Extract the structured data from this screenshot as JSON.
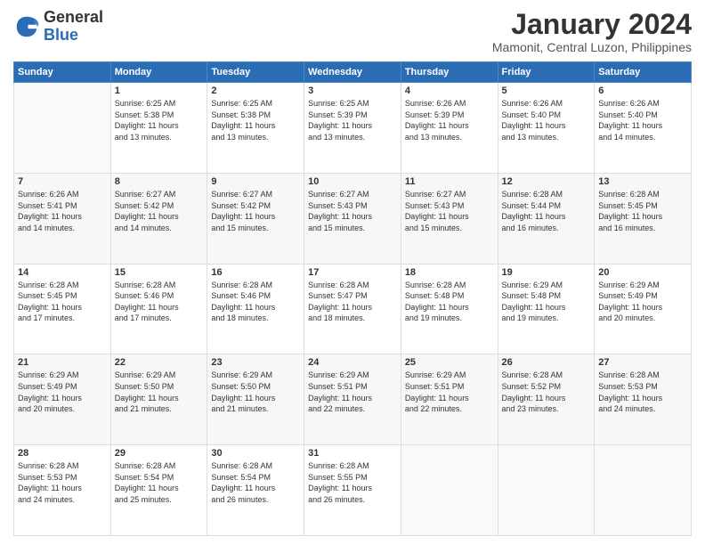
{
  "logo": {
    "general": "General",
    "blue": "Blue"
  },
  "header": {
    "month": "January 2024",
    "location": "Mamonit, Central Luzon, Philippines"
  },
  "weekdays": [
    "Sunday",
    "Monday",
    "Tuesday",
    "Wednesday",
    "Thursday",
    "Friday",
    "Saturday"
  ],
  "weeks": [
    [
      {
        "day": "",
        "sunrise": "",
        "sunset": "",
        "daylight": ""
      },
      {
        "day": "1",
        "sunrise": "Sunrise: 6:25 AM",
        "sunset": "Sunset: 5:38 PM",
        "daylight": "Daylight: 11 hours and 13 minutes."
      },
      {
        "day": "2",
        "sunrise": "Sunrise: 6:25 AM",
        "sunset": "Sunset: 5:38 PM",
        "daylight": "Daylight: 11 hours and 13 minutes."
      },
      {
        "day": "3",
        "sunrise": "Sunrise: 6:25 AM",
        "sunset": "Sunset: 5:39 PM",
        "daylight": "Daylight: 11 hours and 13 minutes."
      },
      {
        "day": "4",
        "sunrise": "Sunrise: 6:26 AM",
        "sunset": "Sunset: 5:39 PM",
        "daylight": "Daylight: 11 hours and 13 minutes."
      },
      {
        "day": "5",
        "sunrise": "Sunrise: 6:26 AM",
        "sunset": "Sunset: 5:40 PM",
        "daylight": "Daylight: 11 hours and 13 minutes."
      },
      {
        "day": "6",
        "sunrise": "Sunrise: 6:26 AM",
        "sunset": "Sunset: 5:40 PM",
        "daylight": "Daylight: 11 hours and 14 minutes."
      }
    ],
    [
      {
        "day": "7",
        "sunrise": "Sunrise: 6:26 AM",
        "sunset": "Sunset: 5:41 PM",
        "daylight": "Daylight: 11 hours and 14 minutes."
      },
      {
        "day": "8",
        "sunrise": "Sunrise: 6:27 AM",
        "sunset": "Sunset: 5:42 PM",
        "daylight": "Daylight: 11 hours and 14 minutes."
      },
      {
        "day": "9",
        "sunrise": "Sunrise: 6:27 AM",
        "sunset": "Sunset: 5:42 PM",
        "daylight": "Daylight: 11 hours and 15 minutes."
      },
      {
        "day": "10",
        "sunrise": "Sunrise: 6:27 AM",
        "sunset": "Sunset: 5:43 PM",
        "daylight": "Daylight: 11 hours and 15 minutes."
      },
      {
        "day": "11",
        "sunrise": "Sunrise: 6:27 AM",
        "sunset": "Sunset: 5:43 PM",
        "daylight": "Daylight: 11 hours and 15 minutes."
      },
      {
        "day": "12",
        "sunrise": "Sunrise: 6:28 AM",
        "sunset": "Sunset: 5:44 PM",
        "daylight": "Daylight: 11 hours and 16 minutes."
      },
      {
        "day": "13",
        "sunrise": "Sunrise: 6:28 AM",
        "sunset": "Sunset: 5:45 PM",
        "daylight": "Daylight: 11 hours and 16 minutes."
      }
    ],
    [
      {
        "day": "14",
        "sunrise": "Sunrise: 6:28 AM",
        "sunset": "Sunset: 5:45 PM",
        "daylight": "Daylight: 11 hours and 17 minutes."
      },
      {
        "day": "15",
        "sunrise": "Sunrise: 6:28 AM",
        "sunset": "Sunset: 5:46 PM",
        "daylight": "Daylight: 11 hours and 17 minutes."
      },
      {
        "day": "16",
        "sunrise": "Sunrise: 6:28 AM",
        "sunset": "Sunset: 5:46 PM",
        "daylight": "Daylight: 11 hours and 18 minutes."
      },
      {
        "day": "17",
        "sunrise": "Sunrise: 6:28 AM",
        "sunset": "Sunset: 5:47 PM",
        "daylight": "Daylight: 11 hours and 18 minutes."
      },
      {
        "day": "18",
        "sunrise": "Sunrise: 6:28 AM",
        "sunset": "Sunset: 5:48 PM",
        "daylight": "Daylight: 11 hours and 19 minutes."
      },
      {
        "day": "19",
        "sunrise": "Sunrise: 6:29 AM",
        "sunset": "Sunset: 5:48 PM",
        "daylight": "Daylight: 11 hours and 19 minutes."
      },
      {
        "day": "20",
        "sunrise": "Sunrise: 6:29 AM",
        "sunset": "Sunset: 5:49 PM",
        "daylight": "Daylight: 11 hours and 20 minutes."
      }
    ],
    [
      {
        "day": "21",
        "sunrise": "Sunrise: 6:29 AM",
        "sunset": "Sunset: 5:49 PM",
        "daylight": "Daylight: 11 hours and 20 minutes."
      },
      {
        "day": "22",
        "sunrise": "Sunrise: 6:29 AM",
        "sunset": "Sunset: 5:50 PM",
        "daylight": "Daylight: 11 hours and 21 minutes."
      },
      {
        "day": "23",
        "sunrise": "Sunrise: 6:29 AM",
        "sunset": "Sunset: 5:50 PM",
        "daylight": "Daylight: 11 hours and 21 minutes."
      },
      {
        "day": "24",
        "sunrise": "Sunrise: 6:29 AM",
        "sunset": "Sunset: 5:51 PM",
        "daylight": "Daylight: 11 hours and 22 minutes."
      },
      {
        "day": "25",
        "sunrise": "Sunrise: 6:29 AM",
        "sunset": "Sunset: 5:51 PM",
        "daylight": "Daylight: 11 hours and 22 minutes."
      },
      {
        "day": "26",
        "sunrise": "Sunrise: 6:28 AM",
        "sunset": "Sunset: 5:52 PM",
        "daylight": "Daylight: 11 hours and 23 minutes."
      },
      {
        "day": "27",
        "sunrise": "Sunrise: 6:28 AM",
        "sunset": "Sunset: 5:53 PM",
        "daylight": "Daylight: 11 hours and 24 minutes."
      }
    ],
    [
      {
        "day": "28",
        "sunrise": "Sunrise: 6:28 AM",
        "sunset": "Sunset: 5:53 PM",
        "daylight": "Daylight: 11 hours and 24 minutes."
      },
      {
        "day": "29",
        "sunrise": "Sunrise: 6:28 AM",
        "sunset": "Sunset: 5:54 PM",
        "daylight": "Daylight: 11 hours and 25 minutes."
      },
      {
        "day": "30",
        "sunrise": "Sunrise: 6:28 AM",
        "sunset": "Sunset: 5:54 PM",
        "daylight": "Daylight: 11 hours and 26 minutes."
      },
      {
        "day": "31",
        "sunrise": "Sunrise: 6:28 AM",
        "sunset": "Sunset: 5:55 PM",
        "daylight": "Daylight: 11 hours and 26 minutes."
      },
      {
        "day": "",
        "sunrise": "",
        "sunset": "",
        "daylight": ""
      },
      {
        "day": "",
        "sunrise": "",
        "sunset": "",
        "daylight": ""
      },
      {
        "day": "",
        "sunrise": "",
        "sunset": "",
        "daylight": ""
      }
    ]
  ]
}
